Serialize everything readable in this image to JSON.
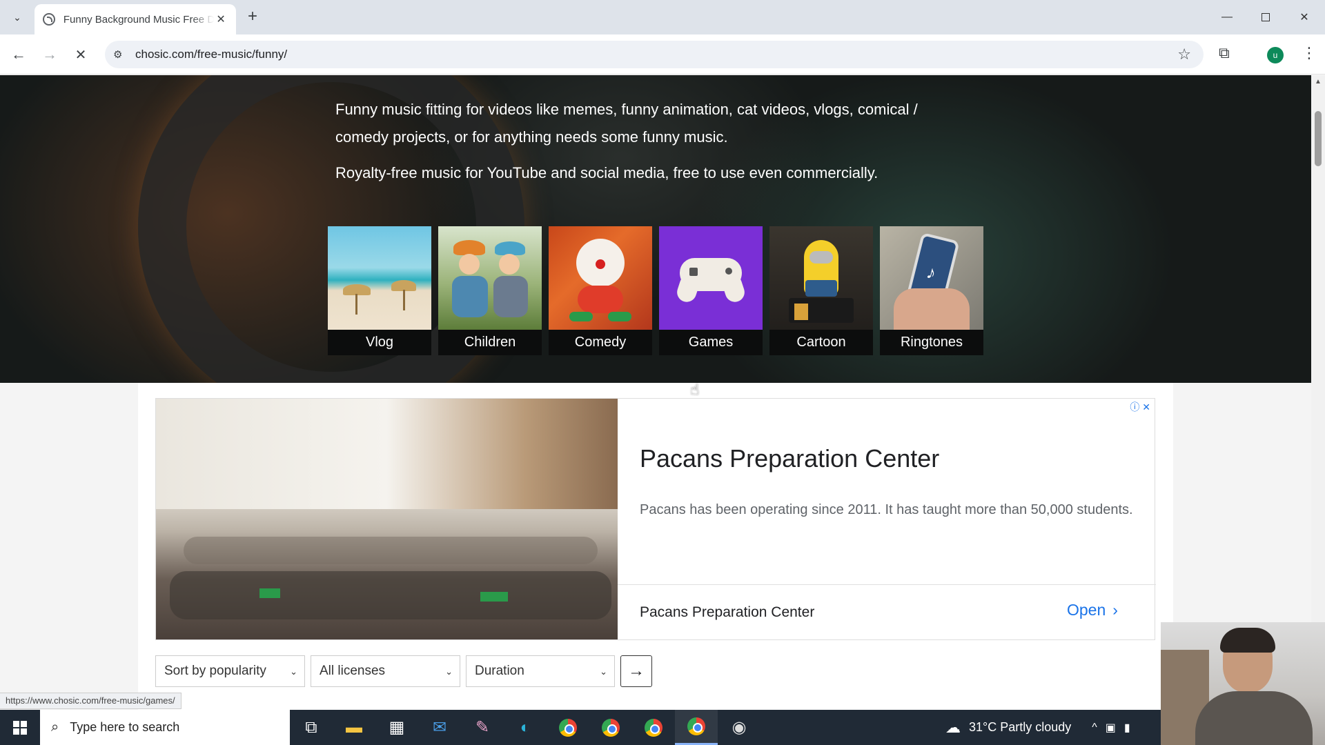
{
  "browser": {
    "tab_title": "Funny Background Music Free D",
    "url": "chosic.com/free-music/funny/",
    "avatar_letter": "u",
    "status_url": "https://www.chosic.com/free-music/games/"
  },
  "hero": {
    "paragraph1": "Funny music fitting for videos like memes, funny animation, cat videos, vlogs, comical / comedy projects, or for anything needs some funny music.",
    "paragraph2": "Royalty-free music for YouTube and social media, free to use even commercially.",
    "categories": [
      {
        "label": "Vlog",
        "icon": "beach-umbrellas-image"
      },
      {
        "label": "Children",
        "icon": "kids-reading-image"
      },
      {
        "label": "Comedy",
        "icon": "clown-toy-image"
      },
      {
        "label": "Games",
        "icon": "gamepad-image"
      },
      {
        "label": "Cartoon",
        "icon": "minion-image"
      },
      {
        "label": "Ringtones",
        "icon": "phone-in-hand-image"
      }
    ]
  },
  "ad": {
    "title": "Pacans Preparation Center",
    "description": "Pacans has been operating since 2011. It has taught more than 50,000 students.",
    "footer_name": "Pacans Preparation Center",
    "cta": "Open",
    "choices_icons": "ⓘ ✕"
  },
  "filters": {
    "sort": "Sort by popularity",
    "license": "All licenses",
    "duration": "Duration",
    "go_icon": "arrow-right-icon"
  },
  "taskbar": {
    "search_placeholder": "Type here to search",
    "weather": "31°C  Partly cloudy"
  },
  "colors": {
    "link_blue": "#1a73e8",
    "games_purple": "#7a2fd6",
    "taskbar": "#202a36"
  }
}
